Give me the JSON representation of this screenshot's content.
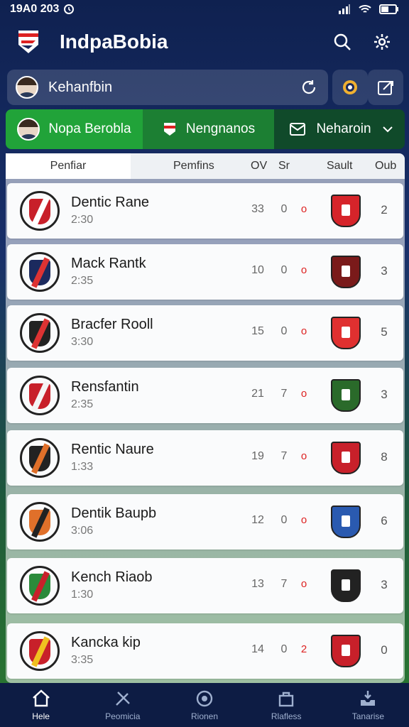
{
  "status": {
    "time": "19A0 203"
  },
  "app": {
    "title": "IndpaBobia"
  },
  "user": {
    "name": "Kehanfbin"
  },
  "tabs": [
    {
      "label": "Nopa Berobla"
    },
    {
      "label": "Nengnanos"
    },
    {
      "label": "Neharoin"
    }
  ],
  "table": {
    "headers": {
      "team": "Penfiar",
      "played": "Pemfins",
      "c1": "OV",
      "c2": "Sr",
      "c3": "Sault",
      "pts": "Oub"
    },
    "rows": [
      {
        "team": "Dentic Rane",
        "time": "2:30",
        "v1": "33",
        "v2": "0",
        "v3": "o",
        "pts": "2",
        "crest": "#c8202a",
        "crest2": "#ffffff",
        "shield": "#d6242a"
      },
      {
        "team": "Mack Rantk",
        "time": "2:35",
        "v1": "10",
        "v2": "0",
        "v3": "o",
        "pts": "3",
        "crest": "#1b2a5e",
        "crest2": "#d33",
        "shield": "#7a1a1a"
      },
      {
        "team": "Bracfer Rooll",
        "time": "3:30",
        "v1": "15",
        "v2": "0",
        "v3": "o",
        "pts": "5",
        "crest": "#222222",
        "crest2": "#d33",
        "shield": "#e03030"
      },
      {
        "team": "Rensfantin",
        "time": "2:35",
        "v1": "21",
        "v2": "7",
        "v3": "o",
        "pts": "3",
        "crest": "#c8202a",
        "crest2": "#f4f4f4",
        "shield": "#2a6a2a"
      },
      {
        "team": "Rentic Naure",
        "time": "1:33",
        "v1": "19",
        "v2": "7",
        "v3": "o",
        "pts": "8",
        "crest": "#222222",
        "crest2": "#e0702a",
        "shield": "#c8202a"
      },
      {
        "team": "Dentik Baupb",
        "time": "3:06",
        "v1": "12",
        "v2": "0",
        "v3": "o",
        "pts": "6",
        "crest": "#e0702a",
        "crest2": "#222",
        "shield": "#2a5ab0"
      },
      {
        "team": "Kench Riaob",
        "time": "1:30",
        "v1": "13",
        "v2": "7",
        "v3": "o",
        "pts": "3",
        "crest": "#2a8a3a",
        "crest2": "#c8202a",
        "shield": "#222222"
      },
      {
        "team": "Kancka kip",
        "time": "3:35",
        "v1": "14",
        "v2": "0",
        "v3": "2",
        "pts": "0",
        "crest": "#c8202a",
        "crest2": "#f0c020",
        "shield": "#c8202a"
      }
    ]
  },
  "nav": [
    {
      "label": "Hele",
      "icon": "home-icon"
    },
    {
      "label": "Peomicia",
      "icon": "tools-icon"
    },
    {
      "label": "Rionen",
      "icon": "target-icon"
    },
    {
      "label": "Rlafless",
      "icon": "bag-icon"
    },
    {
      "label": "Tanarise",
      "icon": "inbox-icon"
    }
  ]
}
